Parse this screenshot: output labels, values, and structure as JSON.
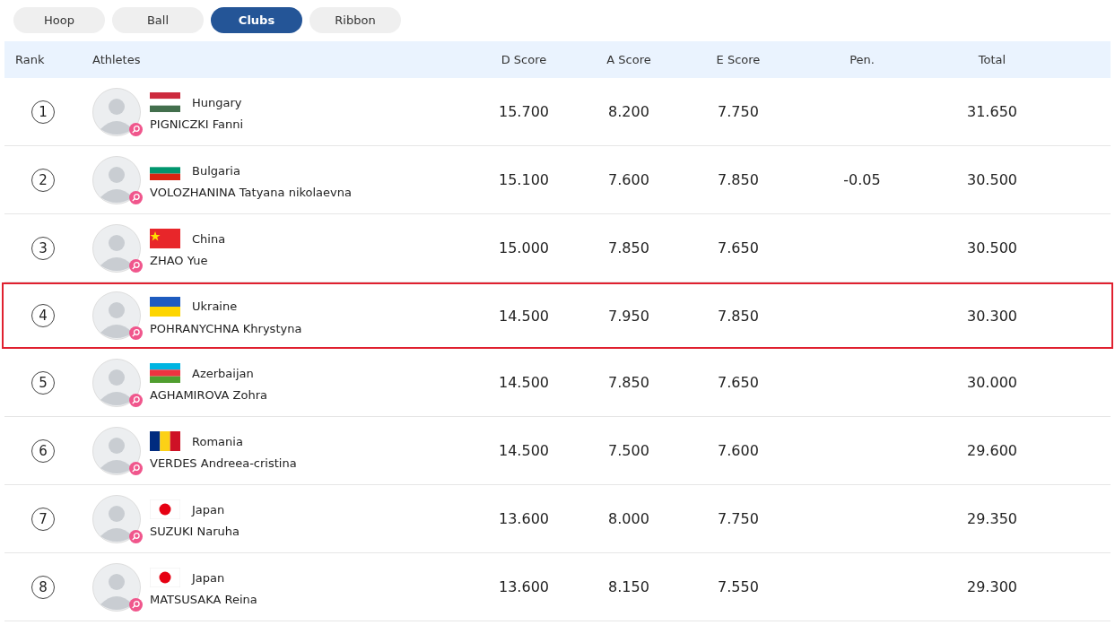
{
  "tabs": [
    {
      "label": "Hoop",
      "selected": false
    },
    {
      "label": "Ball",
      "selected": false
    },
    {
      "label": "Clubs",
      "selected": true
    },
    {
      "label": "Ribbon",
      "selected": false
    }
  ],
  "table": {
    "columns": [
      "Rank",
      "Athletes",
      "D Score",
      "A Score",
      "E Score",
      "Pen.",
      "Total"
    ],
    "rows": [
      {
        "rank": "1",
        "country": "Hungary",
        "flag": {
          "kind": "horizontal",
          "parts": [
            {
              "color": "#cd2a3e"
            },
            {
              "color": "#ffffff"
            },
            {
              "color": "#436f4d"
            }
          ]
        },
        "athlete": "PIGNICZKI Fanni",
        "d_score": "15.700",
        "a_score": "8.200",
        "e_score": "7.750",
        "penalty": "",
        "total": "31.650",
        "highlighted": false
      },
      {
        "rank": "2",
        "country": "Bulgaria",
        "flag": {
          "kind": "horizontal",
          "parts": [
            {
              "color": "#ffffff"
            },
            {
              "color": "#00966e"
            },
            {
              "color": "#d62612"
            }
          ]
        },
        "athlete": "VOLOZHANINA Tatyana nikolaevna",
        "d_score": "15.100",
        "a_score": "7.600",
        "e_score": "7.850",
        "penalty": "-0.05",
        "total": "30.500",
        "highlighted": false
      },
      {
        "rank": "3",
        "country": "China",
        "flag": {
          "kind": "star",
          "parts": [
            {
              "color": "#e8262a"
            },
            {
              "color": "#ffde00"
            }
          ]
        },
        "athlete": "ZHAO Yue",
        "d_score": "15.000",
        "a_score": "7.850",
        "e_score": "7.650",
        "penalty": "",
        "total": "30.500",
        "highlighted": false
      },
      {
        "rank": "4",
        "country": "Ukraine",
        "flag": {
          "kind": "horizontal",
          "parts": [
            {
              "color": "#1d5bbf"
            },
            {
              "color": "#fdd500"
            }
          ]
        },
        "athlete": "POHRANYCHNA Khrystyna",
        "d_score": "14.500",
        "a_score": "7.950",
        "e_score": "7.850",
        "penalty": "",
        "total": "30.300",
        "highlighted": true
      },
      {
        "rank": "5",
        "country": "Azerbaijan",
        "flag": {
          "kind": "horizontal",
          "parts": [
            {
              "color": "#00b5e2"
            },
            {
              "color": "#ef3340"
            },
            {
              "color": "#509e2f"
            }
          ]
        },
        "athlete": "AGHAMIROVA Zohra",
        "d_score": "14.500",
        "a_score": "7.850",
        "e_score": "7.650",
        "penalty": "",
        "total": "30.000",
        "highlighted": false
      },
      {
        "rank": "6",
        "country": "Romania",
        "flag": {
          "kind": "vertical",
          "parts": [
            {
              "color": "#002b7f"
            },
            {
              "color": "#fcd116"
            },
            {
              "color": "#ce1126"
            }
          ]
        },
        "athlete": "VERDES Andreea-cristina",
        "d_score": "14.500",
        "a_score": "7.500",
        "e_score": "7.600",
        "penalty": "",
        "total": "29.600",
        "highlighted": false
      },
      {
        "rank": "7",
        "country": "Japan",
        "flag": {
          "kind": "disc",
          "parts": [
            {
              "color": "#ffffff"
            },
            {
              "color": "#e60012"
            }
          ]
        },
        "athlete": "SUZUKI Naruha",
        "d_score": "13.600",
        "a_score": "8.000",
        "e_score": "7.750",
        "penalty": "",
        "total": "29.350",
        "highlighted": false
      },
      {
        "rank": "8",
        "country": "Japan",
        "flag": {
          "kind": "disc",
          "parts": [
            {
              "color": "#ffffff"
            },
            {
              "color": "#e60012"
            }
          ]
        },
        "athlete": "MATSUSAKA Reina",
        "d_score": "13.600",
        "a_score": "8.150",
        "e_score": "7.550",
        "penalty": "",
        "total": "29.300",
        "highlighted": false
      }
    ]
  }
}
